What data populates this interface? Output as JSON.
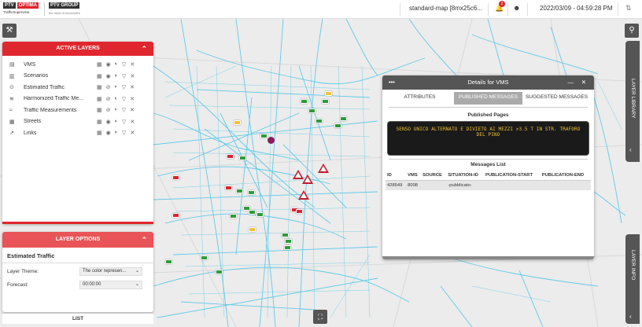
{
  "app": {
    "logo_ptv": "PTV",
    "logo_optima": "OPTIMA",
    "logo_sub": "TrafficSupervisor",
    "group_name": "PTV GROUP",
    "group_tagline": "the mind of movement",
    "map_title": "standard-map [8mx25c6...",
    "notification_count": "2",
    "datetime": "2022/03/09 - 04:59:28 PM"
  },
  "layers_panel": {
    "title": "ACTIVE LAYERS",
    "items": [
      {
        "label": "VMS",
        "icon": "vms-icon"
      },
      {
        "label": "Scenarios",
        "icon": "scenarios-icon"
      },
      {
        "label": "Estimated Traffic",
        "icon": "estimated-traffic-icon"
      },
      {
        "label": "Harmonized Traffic Me...",
        "icon": "harmonized-traffic-icon"
      },
      {
        "label": "Traffic Measurements",
        "icon": "traffic-measurements-icon"
      },
      {
        "label": "Streets",
        "icon": "streets-icon"
      },
      {
        "label": "Links",
        "icon": "links-icon"
      }
    ]
  },
  "options_panel": {
    "title": "LAYER OPTIONS",
    "layer_name": "Estimated Traffic",
    "theme_label": "Layer Theme:",
    "theme_value": "The color represen...",
    "forecast_label": "Forecast:",
    "forecast_value": "00:00:00"
  },
  "list_button": "LIST",
  "right_tabs": {
    "library": "LAYER LIBRARY",
    "info": "LAYER INFO"
  },
  "details": {
    "title": "Details for VMS",
    "tabs": [
      "ATTRIBUTES",
      "PUBLISHED MESSAGES",
      "SUGGESTED MESSAGES"
    ],
    "active_tab": "PUBLISHED MESSAGES",
    "published_pages_title": "Published Pages",
    "vms_text": "SENSO UNICO ALTERNATO E DIVIETO AI MEZZI >3.5 T IN STR. TRAFORO DEL PINO",
    "messages_list_title": "Messages List",
    "columns": [
      "ID",
      "VMS",
      "SOURCE",
      "SITUATION-ID",
      "PUBLICATION-START",
      "PUBLICATION-END"
    ],
    "rows": [
      [
        "428549",
        "8008",
        "",
        "-pubblicato-",
        "",
        ""
      ]
    ]
  },
  "colors": {
    "brand_red": "#e0262e",
    "map_roads": "#5bc8e8",
    "panel_dark": "#555555"
  }
}
